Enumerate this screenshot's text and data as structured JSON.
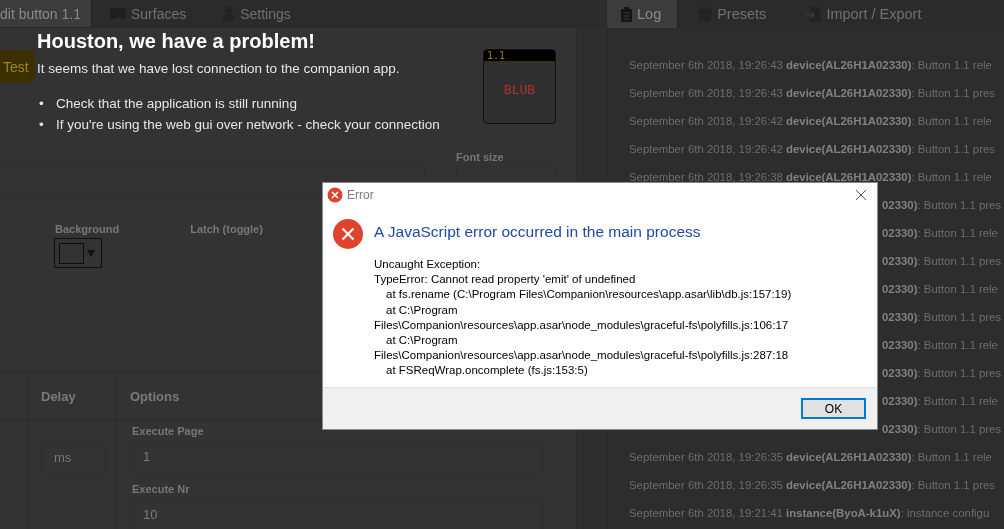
{
  "left_tabs": [
    {
      "label": "dit button 1.1",
      "selected": true
    },
    {
      "label": "Surfaces",
      "selected": false
    },
    {
      "label": "Settings",
      "selected": false
    }
  ],
  "test_button": "Test",
  "preview": {
    "page_label": "1.1",
    "text": "BLUB"
  },
  "font_size_label": "Font size",
  "background_label": "Background",
  "latch_label": "Latch (toggle)",
  "actions_table": {
    "columns": [
      "Delay",
      "Options"
    ]
  },
  "delay_field": {
    "placeholder": "ms"
  },
  "options": [
    {
      "label": "Execute Page",
      "value": "1"
    },
    {
      "label": "Execute Nr",
      "value": "10"
    }
  ],
  "disconnect_overlay": {
    "title": "Houston, we have a problem!",
    "message": "It seems that we have lost connection to the companion app.",
    "tips": [
      {
        "bullet": "•",
        "text": "Check that the application is still running"
      },
      {
        "bullet": "•",
        "text": "If you're using the web gui over network - check your connection"
      }
    ]
  },
  "right_tabs": [
    {
      "label": "Log",
      "selected": true
    },
    {
      "label": "Presets",
      "selected": false
    },
    {
      "label": "Import / Export",
      "selected": false
    }
  ],
  "log": [
    {
      "kind": "full",
      "text": "September 6th 2018, 19:26:43 **device(AL26H1A02330)**: Button 1.1 rele"
    },
    {
      "kind": "full",
      "text": "September 6th 2018, 19:26:43 **device(AL26H1A02330)**: Button 1.1 pres"
    },
    {
      "kind": "full",
      "text": "September 6th 2018, 19:26:42 **device(AL26H1A02330)**: Button 1.1 rele"
    },
    {
      "kind": "full",
      "text": "September 6th 2018, 19:26:42 **device(AL26H1A02330)**: Button 1.1 pres"
    },
    {
      "kind": "full",
      "text": "September 6th 2018, 19:26:38 **device(AL26H1A02330)**: Button 1.1 rele"
    },
    {
      "kind": "partial",
      "text": "**02330)**: Button 1.1 pres"
    },
    {
      "kind": "partial",
      "text": "**02330)**: Button 1.1 rele"
    },
    {
      "kind": "partial",
      "text": "**02330)**: Button 1.1 pres"
    },
    {
      "kind": "partial",
      "text": "**02330)**: Button 1.1 rele"
    },
    {
      "kind": "partial",
      "text": "**02330)**: Button 1.1 pres"
    },
    {
      "kind": "partial",
      "text": "**02330)**: Button 1.1 rele"
    },
    {
      "kind": "partial",
      "text": "**02330)**: Button 1.1 pres"
    },
    {
      "kind": "partial",
      "text": "**02330)**: Button 1.1 rele"
    },
    {
      "kind": "partial",
      "text": "**02330)**: Button 1.1 pres"
    },
    {
      "kind": "full",
      "text": "September 6th 2018, 19:26:35 **device(AL26H1A02330)**: Button 1.1 rele"
    },
    {
      "kind": "full",
      "text": "September 6th 2018, 19:26:35 **device(AL26H1A02330)**: Button 1.1 pres"
    },
    {
      "kind": "full",
      "text": "September 6th 2018, 19:21:41 **instance(ByoA-k1uX)**: instance configu"
    }
  ],
  "dialog": {
    "title": "Error",
    "heading": "A JavaScript error occurred in the main process",
    "lines": [
      {
        "kind": "text",
        "text": "Uncaught Exception:"
      },
      {
        "kind": "text",
        "text": "TypeError: Cannot read property 'emit' of undefined"
      },
      {
        "kind": "frame",
        "text": "at fs.rename (C:\\Program Files\\Companion\\resources\\app.asar\\lib\\db.js:157:19)"
      },
      {
        "kind": "frame",
        "text": "at C:\\Program"
      },
      {
        "kind": "text",
        "text": "Files\\Companion\\resources\\app.asar\\node_modules\\graceful-fs\\polyfills.js:106:17"
      },
      {
        "kind": "frame",
        "text": "at C:\\Program"
      },
      {
        "kind": "text",
        "text": "Files\\Companion\\resources\\app.asar\\node_modules\\graceful-fs\\polyfills.js:287:18"
      },
      {
        "kind": "frame",
        "text": "at FSReqWrap.oncomplete (fs.js:153:5)"
      }
    ],
    "button": "OK"
  }
}
